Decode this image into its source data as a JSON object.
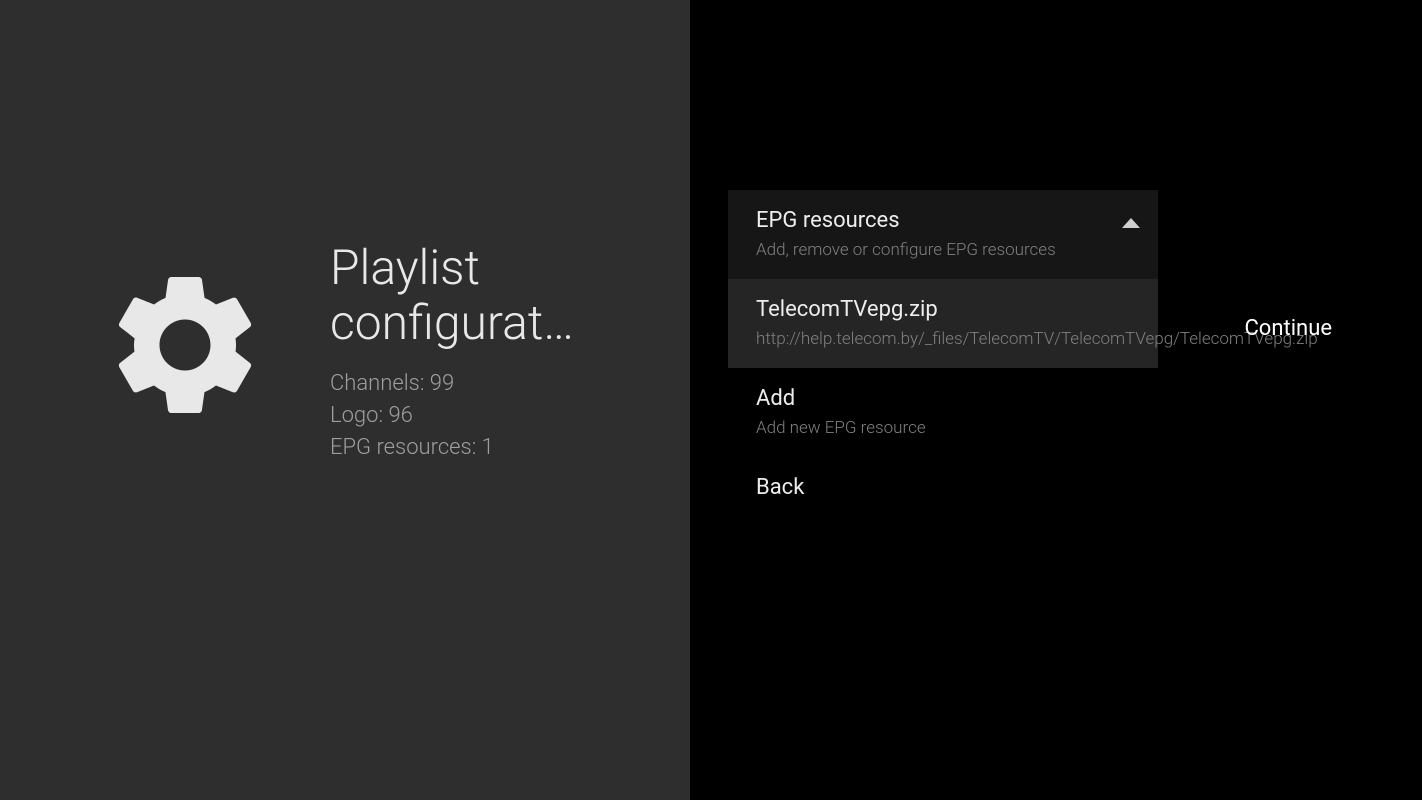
{
  "left": {
    "title": "Playlist configurat…",
    "channels_label": "Channels: 99",
    "logo_label": "Logo: 96",
    "epg_label": "EPG resources: 1"
  },
  "menu": {
    "header": {
      "title": "EPG resources",
      "subtitle": "Add, remove or configure EPG resources"
    },
    "resource": {
      "title": "TelecomTVepg.zip",
      "subtitle": "http://help.telecom.by/_files/TelecomTV/TelecomTVepg/TelecomTVepg.zip"
    },
    "add": {
      "title": "Add",
      "subtitle": "Add new EPG resource"
    },
    "back": {
      "title": "Back"
    }
  },
  "continue_label": "Continue"
}
